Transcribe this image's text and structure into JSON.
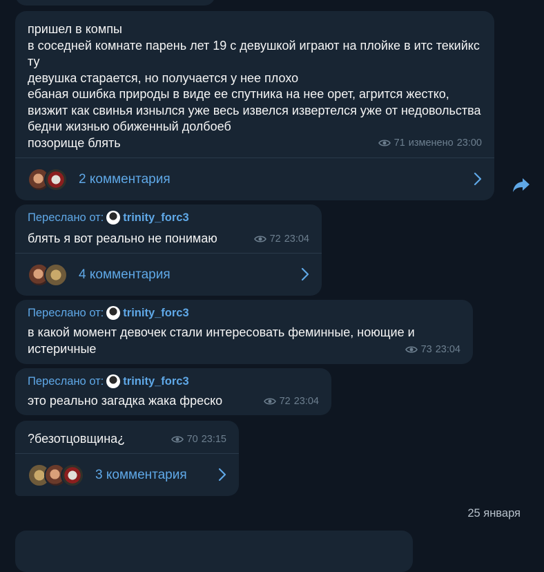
{
  "messages": [
    {
      "text": "пришел в компы\nв соседней комнате парень лет 19 с девушкой играют на плойке в итс текийкс ту\nдевушка старается, но получается у нее плохо\nебаная ошибка природы в виде ее спутника на нее орет, агрится жестко, визжит как свинья изнылся уже весь извелся извертелся уже от недовольства бедни жизнью обиженный долбоеб\nпозорище блять",
      "views": "71",
      "edited": "изменено",
      "time": "23:00",
      "comments": "2 комментария"
    },
    {
      "forwarded_label": "Переслано от:",
      "forwarded_from": "trinity_forc3",
      "text": "блять я вот реально не понимаю",
      "views": "72",
      "time": "23:04",
      "comments": "4 комментария"
    },
    {
      "forwarded_label": "Переслано от:",
      "forwarded_from": "trinity_forc3",
      "text": "в какой момент девочек стали интересовать феминные, ноющие и истеричные",
      "views": "73",
      "time": "23:04"
    },
    {
      "forwarded_label": "Переслано от:",
      "forwarded_from": "trinity_forc3",
      "text": "это реально загадка жака фреско",
      "views": "72",
      "time": "23:04"
    },
    {
      "text": "?безотцовщина¿",
      "views": "70",
      "time": "23:15",
      "comments": "3 комментария"
    }
  ],
  "date_separator": "25 января",
  "icons": {
    "views": "eye-icon",
    "comments_arrow": "chevron-right-icon",
    "share": "share-icon"
  },
  "colors": {
    "background": "#0e1621",
    "bubble": "#182533",
    "accent": "#5fa8e7",
    "meta": "#6d7f8f"
  }
}
